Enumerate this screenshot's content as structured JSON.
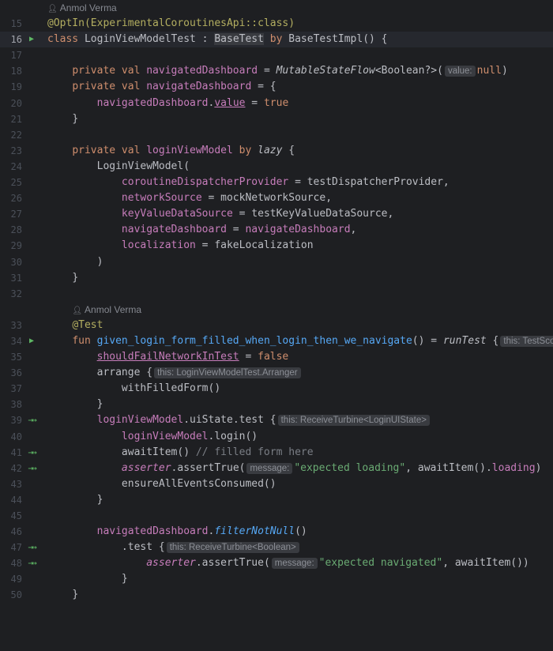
{
  "author_hints": [
    "Anmol Verma",
    "Anmol Verma"
  ],
  "lines": [
    {
      "n": "15",
      "icon": ""
    },
    {
      "n": "16",
      "icon": "run"
    },
    {
      "n": "17",
      "icon": ""
    },
    {
      "n": "18",
      "icon": ""
    },
    {
      "n": "19",
      "icon": ""
    },
    {
      "n": "20",
      "icon": ""
    },
    {
      "n": "21",
      "icon": ""
    },
    {
      "n": "22",
      "icon": ""
    },
    {
      "n": "23",
      "icon": ""
    },
    {
      "n": "24",
      "icon": ""
    },
    {
      "n": "25",
      "icon": ""
    },
    {
      "n": "26",
      "icon": ""
    },
    {
      "n": "27",
      "icon": ""
    },
    {
      "n": "28",
      "icon": ""
    },
    {
      "n": "29",
      "icon": ""
    },
    {
      "n": "30",
      "icon": ""
    },
    {
      "n": "31",
      "icon": ""
    },
    {
      "n": "32",
      "icon": ""
    },
    {
      "n": "33",
      "icon": ""
    },
    {
      "n": "34",
      "icon": "run"
    },
    {
      "n": "35",
      "icon": ""
    },
    {
      "n": "36",
      "icon": ""
    },
    {
      "n": "37",
      "icon": ""
    },
    {
      "n": "38",
      "icon": ""
    },
    {
      "n": "39",
      "icon": "step"
    },
    {
      "n": "40",
      "icon": ""
    },
    {
      "n": "41",
      "icon": "step"
    },
    {
      "n": "42",
      "icon": "step"
    },
    {
      "n": "43",
      "icon": ""
    },
    {
      "n": "44",
      "icon": ""
    },
    {
      "n": "45",
      "icon": ""
    },
    {
      "n": "46",
      "icon": ""
    },
    {
      "n": "47",
      "icon": "step"
    },
    {
      "n": "48",
      "icon": "step"
    },
    {
      "n": "49",
      "icon": ""
    },
    {
      "n": "50",
      "icon": ""
    }
  ],
  "t": {
    "l15": "@OptIn(ExperimentalCoroutinesApi::class)",
    "l16_class": "class ",
    "l16_name": "LoginViewModelTest : ",
    "l16_base": "BaseTest",
    "l16_by": " by ",
    "l16_rest": "BaseTestImpl() {",
    "l18_pv": "private val ",
    "l18_prop": "navigatedDashboard",
    "l18_eq": " = ",
    "l18_fn": "MutableStateFlow",
    "l18_type": "<Boolean?>(",
    "l18_hint": "value:",
    "l18_null": "null",
    "l18_close": ")",
    "l19_pv": "private val ",
    "l19_prop": "navigateDashboard",
    "l19_rest": " = {",
    "l20_prop": "navigatedDashboard",
    "l20_dot": ".",
    "l20_value": "value",
    "l20_eq": " = ",
    "l20_true": "true",
    "l21": "}",
    "l23_pv": "private val ",
    "l23_prop": "loginViewModel",
    "l23_by": " by ",
    "l23_lazy": "lazy",
    "l23_brace": " {",
    "l24": "LoginViewModel(",
    "l25_p": "coroutineDispatcherProvider",
    "l25_rest": " = testDispatcherProvider,",
    "l26_p": "networkSource",
    "l26_rest": " = mockNetworkSource,",
    "l27_p": "keyValueDataSource",
    "l27_rest": " = testKeyValueDataSource,",
    "l28_p": "navigateDashboard",
    "l28_eq": " = ",
    "l28_v": "navigateDashboard",
    "l28_c": ",",
    "l29_p": "localization",
    "l29_rest": " = fakeLocalization",
    "l30": ")",
    "l31": "}",
    "l33": "@Test",
    "l34_fun": "fun ",
    "l34_name": "given_login_form_filled_when_login_then_we_navigate",
    "l34_mid": "() = ",
    "l34_run": "runTest",
    "l34_brace": " {",
    "l34_hint": "this: TestScope",
    "l35_prop": "shouldFailNetworkInTest",
    "l35_eq": " = ",
    "l35_false": "false",
    "l36_a": "arrange {",
    "l36_hint": "this: LoginViewModelTest.Arranger",
    "l37": "withFilledForm()",
    "l38": "}",
    "l39_prop": "loginViewModel",
    "l39_rest": ".uiState.test {",
    "l39_hint": "this: ReceiveTurbine<LoginUIState>",
    "l40_prop": "loginViewModel",
    "l40_rest": ".login()",
    "l41_code": "awaitItem() ",
    "l41_cmt": "// filled form here",
    "l42_prop": "asserter",
    "l42_mid": ".assertTrue(",
    "l42_hint": "message:",
    "l42_str": "\"expected loading\"",
    "l42_mid2": ", awaitItem().",
    "l42_load": "loading",
    "l42_close": ")",
    "l43": "ensureAllEventsConsumed()",
    "l44": "}",
    "l46_prop": "navigatedDashboard",
    "l46_dot": ".",
    "l46_fn": "filterNotNull",
    "l46_close": "()",
    "l47_test": ".test {",
    "l47_hint": "this: ReceiveTurbine<Boolean>",
    "l48_prop": "asserter",
    "l48_mid": ".assertTrue(",
    "l48_hint": "message:",
    "l48_str": "\"expected navigated\"",
    "l48_rest": ", awaitItem())",
    "l49": "}",
    "l50": "}"
  },
  "colors": {
    "background": "#1e1f22",
    "keyword": "#cf8e6d",
    "property": "#c77dbb",
    "function": "#56a8f5",
    "string": "#6aab73",
    "annotation": "#b3ae60",
    "comment": "#7a7e85",
    "run_icon": "#5fb865"
  }
}
